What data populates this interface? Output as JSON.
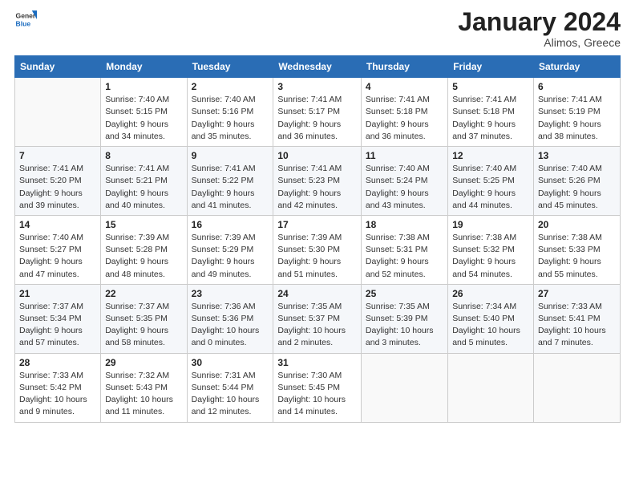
{
  "header": {
    "logo_general": "General",
    "logo_blue": "Blue",
    "month_year": "January 2024",
    "location": "Alimos, Greece"
  },
  "days_of_week": [
    "Sunday",
    "Monday",
    "Tuesday",
    "Wednesday",
    "Thursday",
    "Friday",
    "Saturday"
  ],
  "weeks": [
    [
      {
        "day": "",
        "sunrise": "",
        "sunset": "",
        "daylight": ""
      },
      {
        "day": "1",
        "sunrise": "Sunrise: 7:40 AM",
        "sunset": "Sunset: 5:15 PM",
        "daylight": "Daylight: 9 hours and 34 minutes."
      },
      {
        "day": "2",
        "sunrise": "Sunrise: 7:40 AM",
        "sunset": "Sunset: 5:16 PM",
        "daylight": "Daylight: 9 hours and 35 minutes."
      },
      {
        "day": "3",
        "sunrise": "Sunrise: 7:41 AM",
        "sunset": "Sunset: 5:17 PM",
        "daylight": "Daylight: 9 hours and 36 minutes."
      },
      {
        "day": "4",
        "sunrise": "Sunrise: 7:41 AM",
        "sunset": "Sunset: 5:18 PM",
        "daylight": "Daylight: 9 hours and 36 minutes."
      },
      {
        "day": "5",
        "sunrise": "Sunrise: 7:41 AM",
        "sunset": "Sunset: 5:18 PM",
        "daylight": "Daylight: 9 hours and 37 minutes."
      },
      {
        "day": "6",
        "sunrise": "Sunrise: 7:41 AM",
        "sunset": "Sunset: 5:19 PM",
        "daylight": "Daylight: 9 hours and 38 minutes."
      }
    ],
    [
      {
        "day": "7",
        "sunrise": "Sunrise: 7:41 AM",
        "sunset": "Sunset: 5:20 PM",
        "daylight": "Daylight: 9 hours and 39 minutes."
      },
      {
        "day": "8",
        "sunrise": "Sunrise: 7:41 AM",
        "sunset": "Sunset: 5:21 PM",
        "daylight": "Daylight: 9 hours and 40 minutes."
      },
      {
        "day": "9",
        "sunrise": "Sunrise: 7:41 AM",
        "sunset": "Sunset: 5:22 PM",
        "daylight": "Daylight: 9 hours and 41 minutes."
      },
      {
        "day": "10",
        "sunrise": "Sunrise: 7:41 AM",
        "sunset": "Sunset: 5:23 PM",
        "daylight": "Daylight: 9 hours and 42 minutes."
      },
      {
        "day": "11",
        "sunrise": "Sunrise: 7:40 AM",
        "sunset": "Sunset: 5:24 PM",
        "daylight": "Daylight: 9 hours and 43 minutes."
      },
      {
        "day": "12",
        "sunrise": "Sunrise: 7:40 AM",
        "sunset": "Sunset: 5:25 PM",
        "daylight": "Daylight: 9 hours and 44 minutes."
      },
      {
        "day": "13",
        "sunrise": "Sunrise: 7:40 AM",
        "sunset": "Sunset: 5:26 PM",
        "daylight": "Daylight: 9 hours and 45 minutes."
      }
    ],
    [
      {
        "day": "14",
        "sunrise": "Sunrise: 7:40 AM",
        "sunset": "Sunset: 5:27 PM",
        "daylight": "Daylight: 9 hours and 47 minutes."
      },
      {
        "day": "15",
        "sunrise": "Sunrise: 7:39 AM",
        "sunset": "Sunset: 5:28 PM",
        "daylight": "Daylight: 9 hours and 48 minutes."
      },
      {
        "day": "16",
        "sunrise": "Sunrise: 7:39 AM",
        "sunset": "Sunset: 5:29 PM",
        "daylight": "Daylight: 9 hours and 49 minutes."
      },
      {
        "day": "17",
        "sunrise": "Sunrise: 7:39 AM",
        "sunset": "Sunset: 5:30 PM",
        "daylight": "Daylight: 9 hours and 51 minutes."
      },
      {
        "day": "18",
        "sunrise": "Sunrise: 7:38 AM",
        "sunset": "Sunset: 5:31 PM",
        "daylight": "Daylight: 9 hours and 52 minutes."
      },
      {
        "day": "19",
        "sunrise": "Sunrise: 7:38 AM",
        "sunset": "Sunset: 5:32 PM",
        "daylight": "Daylight: 9 hours and 54 minutes."
      },
      {
        "day": "20",
        "sunrise": "Sunrise: 7:38 AM",
        "sunset": "Sunset: 5:33 PM",
        "daylight": "Daylight: 9 hours and 55 minutes."
      }
    ],
    [
      {
        "day": "21",
        "sunrise": "Sunrise: 7:37 AM",
        "sunset": "Sunset: 5:34 PM",
        "daylight": "Daylight: 9 hours and 57 minutes."
      },
      {
        "day": "22",
        "sunrise": "Sunrise: 7:37 AM",
        "sunset": "Sunset: 5:35 PM",
        "daylight": "Daylight: 9 hours and 58 minutes."
      },
      {
        "day": "23",
        "sunrise": "Sunrise: 7:36 AM",
        "sunset": "Sunset: 5:36 PM",
        "daylight": "Daylight: 10 hours and 0 minutes."
      },
      {
        "day": "24",
        "sunrise": "Sunrise: 7:35 AM",
        "sunset": "Sunset: 5:37 PM",
        "daylight": "Daylight: 10 hours and 2 minutes."
      },
      {
        "day": "25",
        "sunrise": "Sunrise: 7:35 AM",
        "sunset": "Sunset: 5:39 PM",
        "daylight": "Daylight: 10 hours and 3 minutes."
      },
      {
        "day": "26",
        "sunrise": "Sunrise: 7:34 AM",
        "sunset": "Sunset: 5:40 PM",
        "daylight": "Daylight: 10 hours and 5 minutes."
      },
      {
        "day": "27",
        "sunrise": "Sunrise: 7:33 AM",
        "sunset": "Sunset: 5:41 PM",
        "daylight": "Daylight: 10 hours and 7 minutes."
      }
    ],
    [
      {
        "day": "28",
        "sunrise": "Sunrise: 7:33 AM",
        "sunset": "Sunset: 5:42 PM",
        "daylight": "Daylight: 10 hours and 9 minutes."
      },
      {
        "day": "29",
        "sunrise": "Sunrise: 7:32 AM",
        "sunset": "Sunset: 5:43 PM",
        "daylight": "Daylight: 10 hours and 11 minutes."
      },
      {
        "day": "30",
        "sunrise": "Sunrise: 7:31 AM",
        "sunset": "Sunset: 5:44 PM",
        "daylight": "Daylight: 10 hours and 12 minutes."
      },
      {
        "day": "31",
        "sunrise": "Sunrise: 7:30 AM",
        "sunset": "Sunset: 5:45 PM",
        "daylight": "Daylight: 10 hours and 14 minutes."
      },
      {
        "day": "",
        "sunrise": "",
        "sunset": "",
        "daylight": ""
      },
      {
        "day": "",
        "sunrise": "",
        "sunset": "",
        "daylight": ""
      },
      {
        "day": "",
        "sunrise": "",
        "sunset": "",
        "daylight": ""
      }
    ]
  ]
}
